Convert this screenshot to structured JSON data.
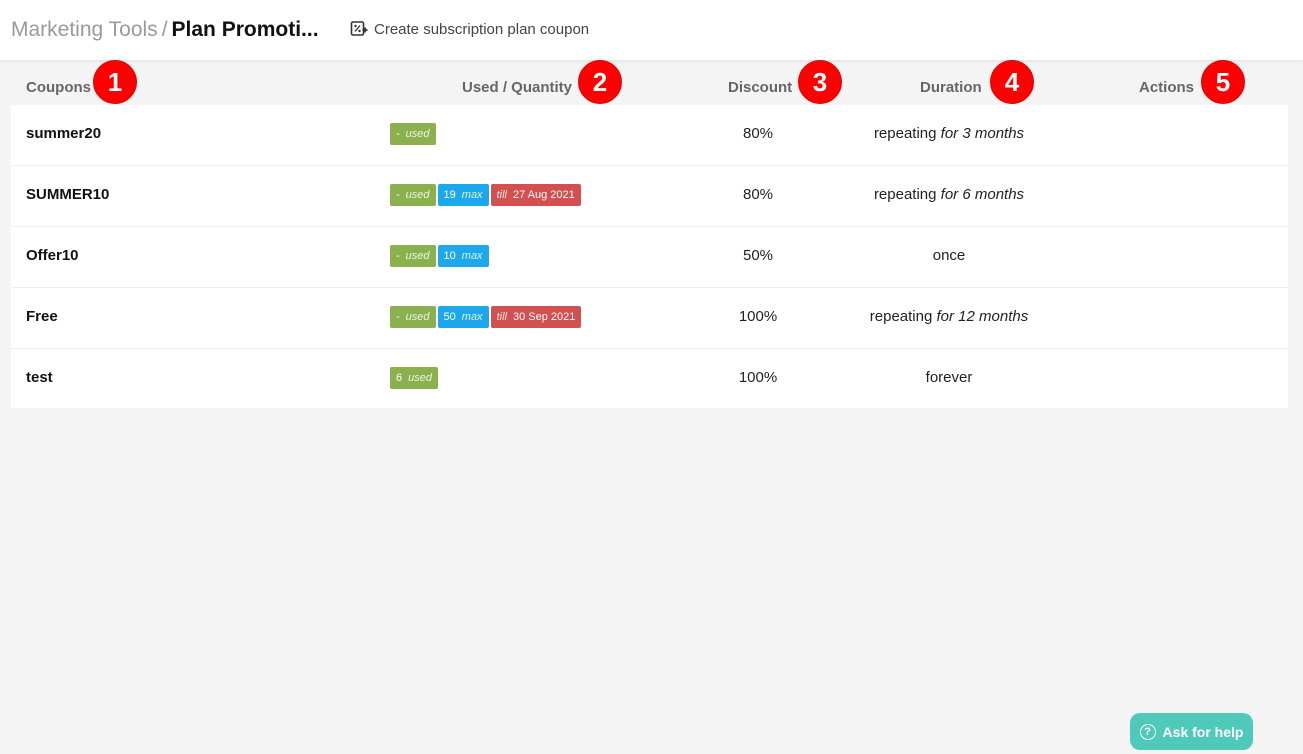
{
  "header": {
    "breadcrumb_parent": "Marketing Tools",
    "breadcrumb_separator": "/",
    "breadcrumb_current": "Plan Promoti...",
    "create_label": "Create subscription plan coupon",
    "create_icon": "coupon-add-icon"
  },
  "table": {
    "columns": {
      "coupons": "Coupons",
      "used": "Used / Quantity",
      "discount": "Discount",
      "duration": "Duration",
      "actions": "Actions"
    },
    "markers": [
      "1",
      "2",
      "3",
      "4",
      "5"
    ],
    "rows": [
      {
        "name": "summer20",
        "used_value": "-",
        "used_label": "used",
        "max_value": "",
        "max_label": "",
        "till_label": "",
        "till_value": "",
        "discount": "80%",
        "duration_base": "repeating",
        "duration_extra": "for 3 months"
      },
      {
        "name": "SUMMER10",
        "used_value": "-",
        "used_label": "used",
        "max_value": "19",
        "max_label": "max",
        "till_label": "till",
        "till_value": "27 Aug 2021",
        "discount": "80%",
        "duration_base": "repeating",
        "duration_extra": "for 6 months"
      },
      {
        "name": "Offer10",
        "used_value": "-",
        "used_label": "used",
        "max_value": "10",
        "max_label": "max",
        "till_label": "",
        "till_value": "",
        "discount": "50%",
        "duration_base": "once",
        "duration_extra": ""
      },
      {
        "name": "Free",
        "used_value": "-",
        "used_label": "used",
        "max_value": "50",
        "max_label": "max",
        "till_label": "till",
        "till_value": "30 Sep 2021",
        "discount": "100%",
        "duration_base": "repeating",
        "duration_extra": "for 12 months"
      },
      {
        "name": "test",
        "used_value": "6",
        "used_label": "used",
        "max_value": "",
        "max_label": "",
        "till_label": "",
        "till_value": "",
        "discount": "100%",
        "duration_base": "forever",
        "duration_extra": ""
      }
    ]
  },
  "help": {
    "label": "Ask for help",
    "icon": "question-circle-icon"
  },
  "colors": {
    "used_badge": "#8bb04e",
    "max_badge": "#1ea8ec",
    "till_badge": "#d35050",
    "marker": "#ff0000",
    "help_button": "#4fc9b9"
  }
}
